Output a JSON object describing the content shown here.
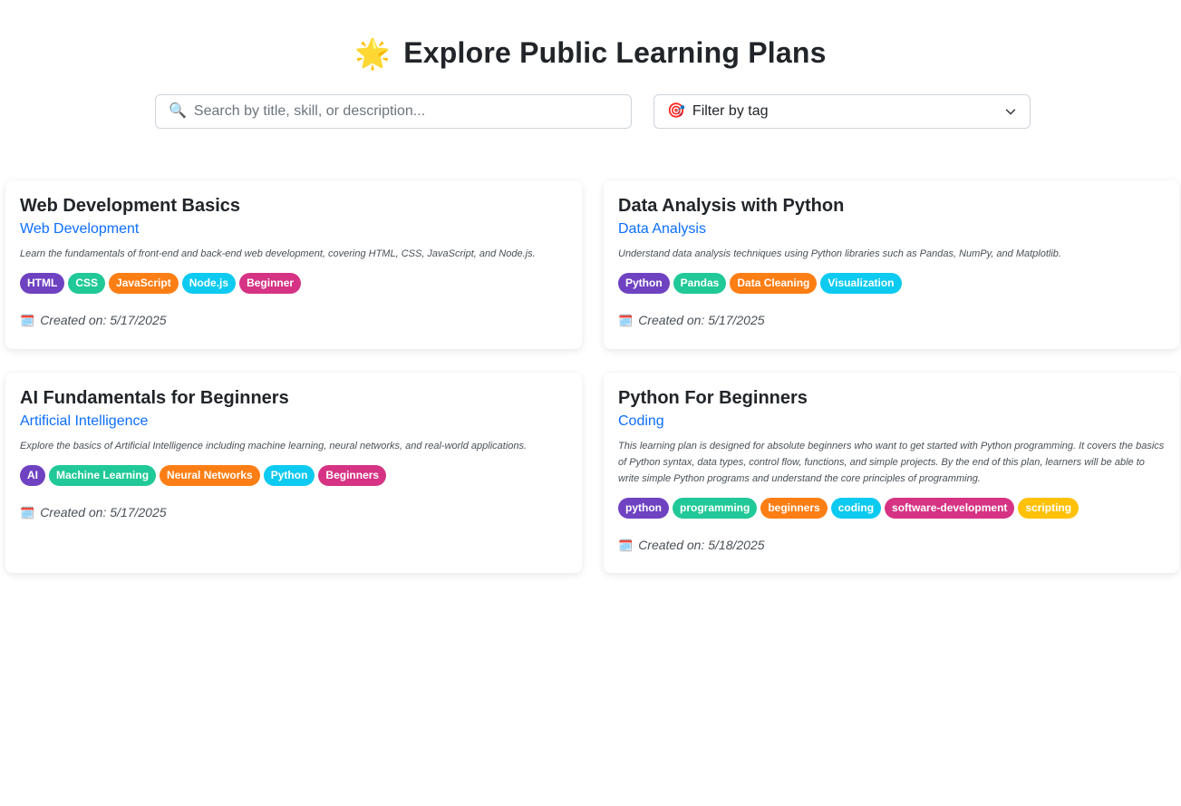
{
  "header": {
    "emoji": "🌟",
    "title": "Explore Public Learning Plans"
  },
  "search": {
    "icon": "magnifier-icon",
    "placeholder": "Search by title, skill, or description..."
  },
  "filter": {
    "icon": "target-icon",
    "label": "Filter by tag"
  },
  "tag_colors": [
    "#6f42c1",
    "#20c997",
    "#fd7e14",
    "#0dcaf0",
    "#d63384",
    "#ffc107"
  ],
  "plans": [
    {
      "title": "Web Development Basics",
      "category": "Web Development",
      "description": "Learn the fundamentals of front-end and back-end web development, covering HTML, CSS, JavaScript, and Node.js.",
      "tags": [
        "HTML",
        "CSS",
        "JavaScript",
        "Node.js",
        "Beginner"
      ],
      "created": "Created on: 5/17/2025"
    },
    {
      "title": "Data Analysis with Python",
      "category": "Data Analysis",
      "description": "Understand data analysis techniques using Python libraries such as Pandas, NumPy, and Matplotlib.",
      "tags": [
        "Python",
        "Pandas",
        "Data Cleaning",
        "Visualization"
      ],
      "created": "Created on: 5/17/2025"
    },
    {
      "title": "AI Fundamentals for Beginners",
      "category": "Artificial Intelligence",
      "description": "Explore the basics of Artificial Intelligence including machine learning, neural networks, and real-world applications.",
      "tags": [
        "AI",
        "Machine Learning",
        "Neural Networks",
        "Python",
        "Beginners"
      ],
      "created": "Created on: 5/17/2025"
    },
    {
      "title": "Python For Beginners",
      "category": "Coding",
      "description": "This learning plan is designed for absolute beginners who want to get started with Python programming. It covers the basics of Python syntax, data types, control flow, functions, and simple projects. By the end of this plan, learners will be able to write simple Python programs and understand the core principles of programming.",
      "tags": [
        "python",
        "programming",
        "beginners",
        "coding",
        "software-development",
        "scripting"
      ],
      "created": "Created on: 5/18/2025"
    }
  ]
}
